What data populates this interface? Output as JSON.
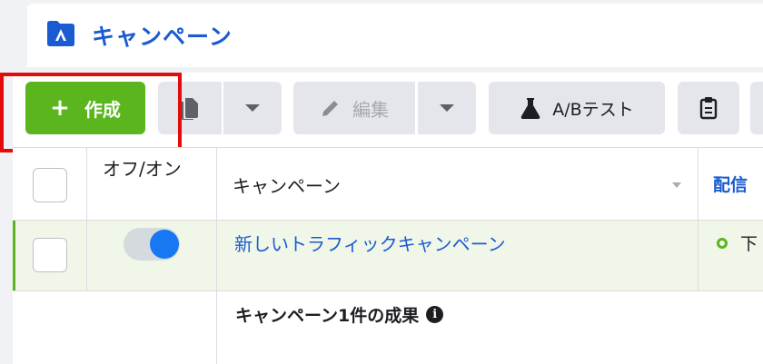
{
  "header": {
    "title": "キャンペーン",
    "icon": "campaign-folder-icon"
  },
  "toolbar": {
    "create_label": "作成",
    "create_icon": "plus-icon",
    "duplicate_icon": "duplicate-icon",
    "edit_label": "編集",
    "edit_icon": "pencil-icon",
    "ab_test_label": "A/Bテスト",
    "ab_test_icon": "flask-icon",
    "report_icon": "clipboard-icon"
  },
  "table": {
    "columns": {
      "onoff": "オフ/オン",
      "campaign": "キャンペーン",
      "delivery": "配信"
    },
    "rows": [
      {
        "name": "新しいトラフィックキャンペーン",
        "enabled": true,
        "status": "下"
      }
    ],
    "summary": "キャンペーン1件の成果"
  },
  "colors": {
    "accent_blue": "#1a5bd1",
    "create_green": "#5ab61c",
    "highlight_red": "#e60b0b",
    "toggle_blue": "#1877f2"
  }
}
